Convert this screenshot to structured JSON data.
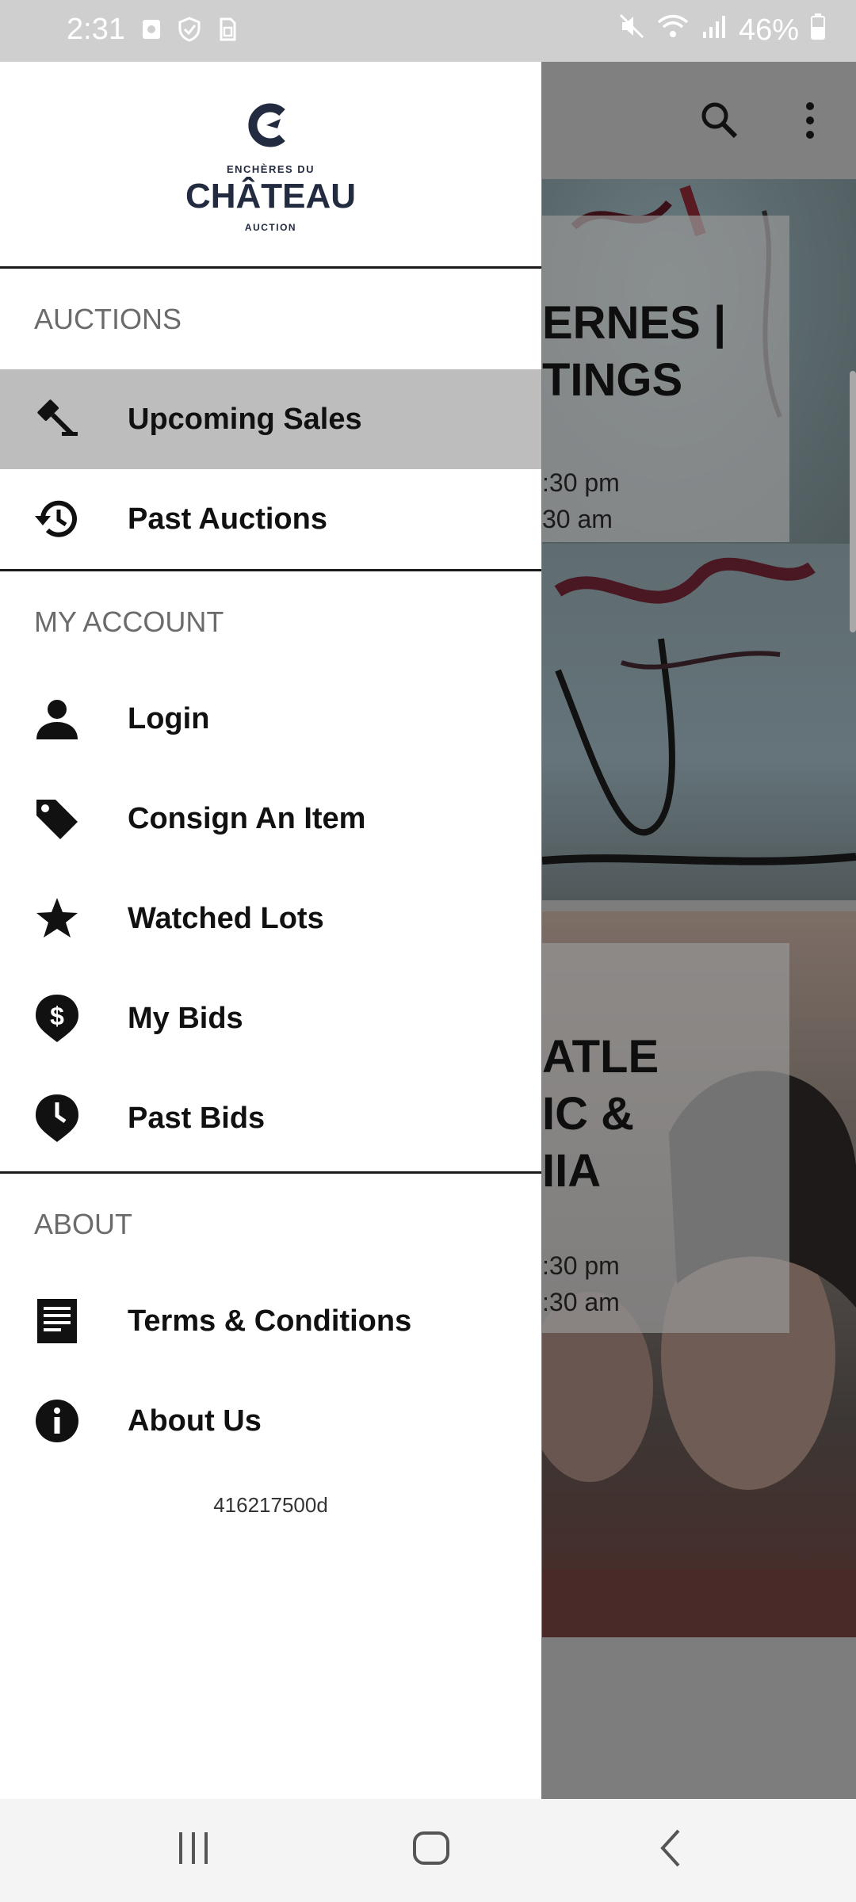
{
  "status_bar": {
    "time": "2:31",
    "battery": "46%"
  },
  "app": {
    "cards": [
      {
        "title_partial": "ERNES |\nTINGS",
        "dates_partial": ":30 pm\n30 am"
      },
      {
        "title_partial": "ATLE\nIC &\nIIA",
        "dates_partial": ":30 pm\n:30 am"
      }
    ]
  },
  "drawer": {
    "logo": {
      "top": "ENCHÈRES DU",
      "main": "CHÂTEAU",
      "sub": "AUCTION"
    },
    "sections": {
      "auctions": "AUCTIONS",
      "my_account": "MY ACCOUNT",
      "about": "ABOUT"
    },
    "items": {
      "upcoming_sales": "Upcoming Sales",
      "past_auctions": "Past Auctions",
      "login": "Login",
      "consign": "Consign An Item",
      "watched_lots": "Watched Lots",
      "my_bids": "My Bids",
      "past_bids": "Past Bids",
      "terms": "Terms & Conditions",
      "about_us": "About Us"
    },
    "version": "416217500d"
  },
  "colors": {
    "brand": "#232b40",
    "active_item_bg": "#bdbdbd",
    "scrim": "#7d7d7d"
  },
  "icons": [
    "gavel-icon",
    "history-icon",
    "person-icon",
    "tag-icon",
    "star-icon",
    "dollar-pin-icon",
    "clock-pin-icon",
    "document-icon",
    "info-icon",
    "search-icon",
    "more-vertical-icon"
  ]
}
